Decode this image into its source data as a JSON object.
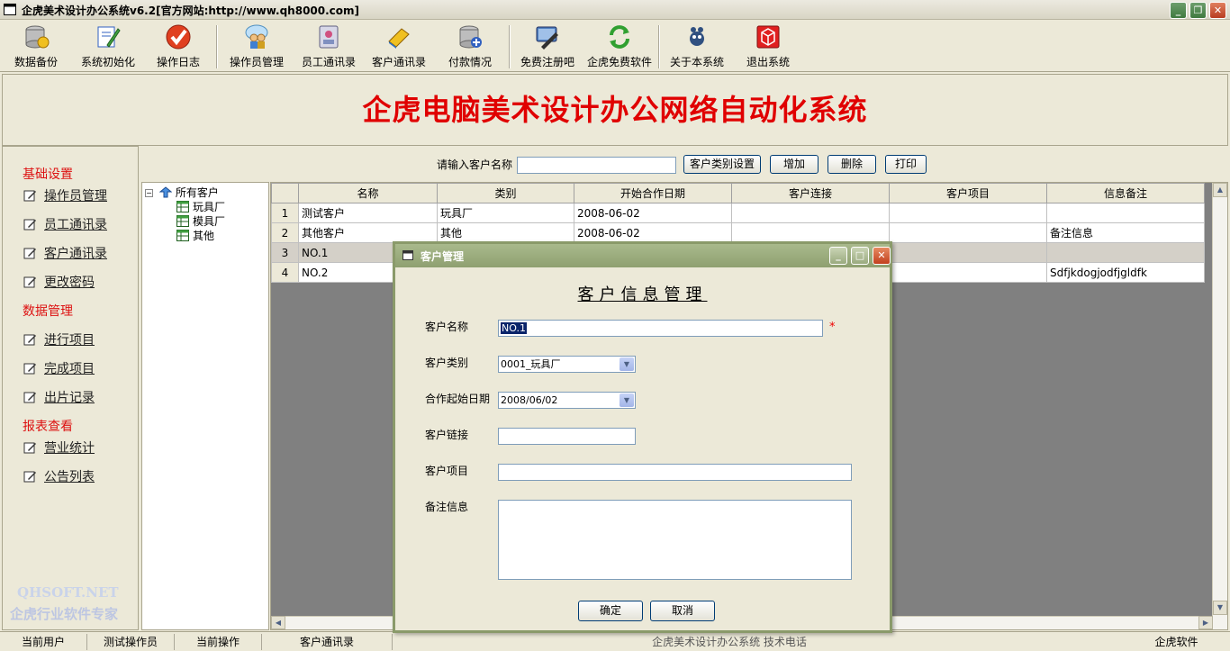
{
  "window": {
    "title": "企虎美术设计办公系统v6.2[官方网站:http://www.qh8000.com]"
  },
  "toolbar": {
    "items": [
      {
        "label": "数据备份",
        "icon": "database-backup-icon"
      },
      {
        "label": "系统初始化",
        "icon": "init-pen-icon"
      },
      {
        "label": "操作日志",
        "icon": "log-check-icon"
      },
      {
        "label": "操作员管理",
        "icon": "users-icon"
      },
      {
        "label": "员工通讯录",
        "icon": "contacts-icon"
      },
      {
        "label": "客户通讯录",
        "icon": "customer-book-icon"
      },
      {
        "label": "付款情况",
        "icon": "payment-db-icon"
      },
      {
        "label": "免费注册吧",
        "icon": "register-icon"
      },
      {
        "label": "企虎免费软件",
        "icon": "refresh-icon"
      },
      {
        "label": "关于本系统",
        "icon": "about-icon"
      },
      {
        "label": "退出系统",
        "icon": "exit-icon"
      }
    ]
  },
  "banner": {
    "title": "企虎电脑美术设计办公网络自动化系统"
  },
  "nav": {
    "sections": [
      {
        "title": "基础设置",
        "items": [
          "操作员管理",
          "员工通讯录",
          "客户通讯录",
          "更改密码"
        ]
      },
      {
        "title": "数据管理",
        "items": [
          "进行项目",
          "完成项目",
          "出片记录"
        ]
      },
      {
        "title": "报表查看",
        "items": [
          "营业统计",
          "公告列表"
        ]
      }
    ],
    "brand_line1": "QHSOFT.NET",
    "brand_line2": "企虎行业软件专家"
  },
  "search": {
    "label": "请输入客户名称",
    "value": "",
    "btn_category": "客户类别设置",
    "btn_add": "增加",
    "btn_delete": "删除",
    "btn_print": "打印"
  },
  "tree": {
    "root": "所有客户",
    "children": [
      "玩具厂",
      "模具厂",
      "其他"
    ]
  },
  "grid": {
    "columns": [
      "名称",
      "类别",
      "开始合作日期",
      "客户连接",
      "客户项目",
      "信息备注"
    ],
    "rows": [
      {
        "n": "1",
        "cells": [
          "测试客户",
          "玩具厂",
          "2008-06-02",
          "",
          "",
          ""
        ]
      },
      {
        "n": "2",
        "cells": [
          "其他客户",
          "其他",
          "2008-06-02",
          "",
          "",
          "备注信息"
        ]
      },
      {
        "n": "3",
        "cells": [
          "NO.1",
          "",
          "",
          "",
          "",
          ""
        ]
      },
      {
        "n": "4",
        "cells": [
          "NO.2",
          "",
          "",
          "",
          "",
          "Sdfjkdogjodfjgldfk"
        ]
      }
    ]
  },
  "statusbar": {
    "current_user_label": "当前用户",
    "current_user": "测试操作员",
    "current_op_label": "当前操作",
    "current_op": "客户通讯录",
    "hidden_text": "企虎美术设计办公系统 技术电话",
    "vendor": "企虎软件"
  },
  "dialog": {
    "title": "客户管理",
    "heading": "客户信息管理",
    "fields": {
      "name_label": "客户名称",
      "name_value": "NO.1",
      "category_label": "客户类别",
      "category_value": "0001_玩具厂",
      "date_label": "合作起始日期",
      "date_value": "2008/06/02",
      "link_label": "客户链接",
      "link_value": "",
      "project_label": "客户项目",
      "project_value": "",
      "notes_label": "备注信息",
      "notes_value": ""
    },
    "required_mark": "*",
    "ok_label": "确定",
    "cancel_label": "取消"
  }
}
